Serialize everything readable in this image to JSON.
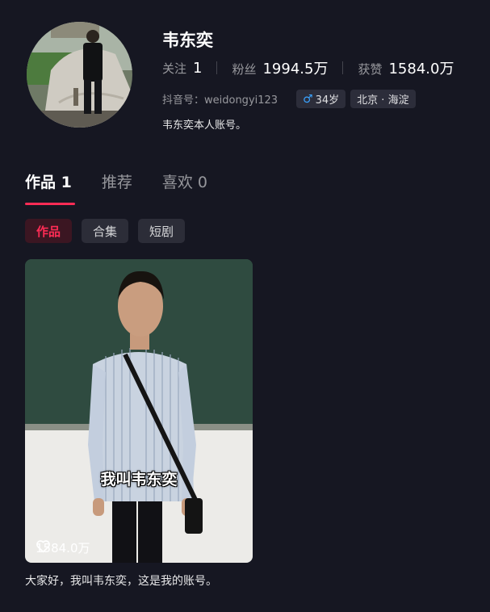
{
  "profile": {
    "name": "韦东奕",
    "stats": [
      {
        "label": "关注",
        "value": "1"
      },
      {
        "label": "粉丝",
        "value": "1994.5万"
      },
      {
        "label": "获赞",
        "value": "1584.0万"
      }
    ],
    "account_id": "抖音号：weidongyi123",
    "gender_icon": "male-icon",
    "age": "34岁",
    "location": "北京 · 海淀",
    "bio": "韦东奕本人账号。"
  },
  "tabs": [
    {
      "label": "作品 1",
      "active": true
    },
    {
      "label": "推荐",
      "active": false
    },
    {
      "label": "喜欢 0",
      "active": false
    }
  ],
  "subtabs": [
    {
      "label": "作品",
      "active": true
    },
    {
      "label": "合集",
      "active": false
    },
    {
      "label": "短剧",
      "active": false
    }
  ],
  "video": {
    "subtitle": "我叫韦东奕",
    "likes": "1584.0万",
    "caption": "大家好，我叫韦东奕，这是我的账号。"
  },
  "colors": {
    "background": "#161722",
    "accent": "#fe2c55",
    "gender": "#3aa3ff"
  }
}
